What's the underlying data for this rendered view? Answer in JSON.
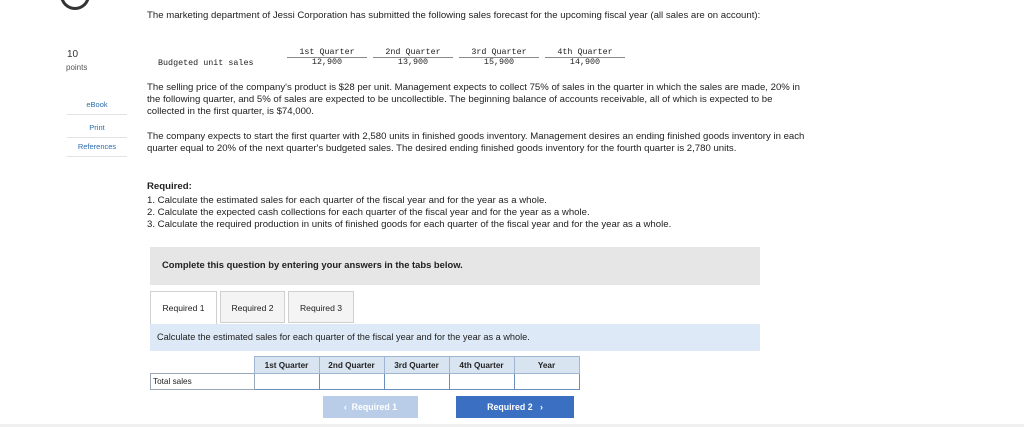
{
  "sidebar": {
    "points_value": "10",
    "points_label": "points",
    "links": [
      "eBook",
      "Print",
      "References"
    ]
  },
  "problem": {
    "intro": "The marketing department of Jessi Corporation has submitted the following sales forecast for the upcoming fiscal year (all sales are on account):",
    "forecast_row_label": "Budgeted unit sales",
    "quarters": [
      "1st Quarter",
      "2nd Quarter",
      "3rd Quarter",
      "4th Quarter"
    ],
    "forecast_values": [
      "12,900",
      "13,900",
      "15,900",
      "14,900"
    ],
    "para_price": "The selling price of the company's product is $28 per unit. Management expects to collect 75% of sales in the quarter in which the sales are made, 20% in the following quarter, and 5% of sales are expected to be uncollectible. The beginning balance of accounts receivable, all of which is expected to be collected in the first quarter, is $74,000.",
    "para_inventory": "The company expects to start the first quarter with 2,580 units in finished goods inventory. Management desires an ending finished goods inventory in each quarter equal to 20% of the next quarter's budgeted sales. The desired ending finished goods inventory for the fourth quarter is 2,780 units.",
    "required_title": "Required:",
    "required_items": [
      "1. Calculate the estimated sales for each quarter of the fiscal year and for the year as a whole.",
      "2. Calculate the expected cash collections for each quarter of the fiscal year and for the year as a whole.",
      "3. Calculate the required production in units of finished goods for each quarter of the fiscal year and for the year as a whole."
    ]
  },
  "banner": "Complete this question by entering your answers in the tabs below.",
  "tabs": [
    "Required 1",
    "Required 2",
    "Required 3"
  ],
  "active_tab": "Required 1",
  "instruction": "Calculate the estimated sales for each quarter of the fiscal year and for the year as a whole.",
  "answer_table": {
    "headers": [
      "1st Quarter",
      "2nd Quarter",
      "3rd Quarter",
      "4th Quarter",
      "Year"
    ],
    "row_label": "Total sales",
    "values": [
      "",
      "",
      "",
      "",
      ""
    ]
  },
  "nav": {
    "prev_label": "Required 1",
    "next_label": "Required 2"
  }
}
